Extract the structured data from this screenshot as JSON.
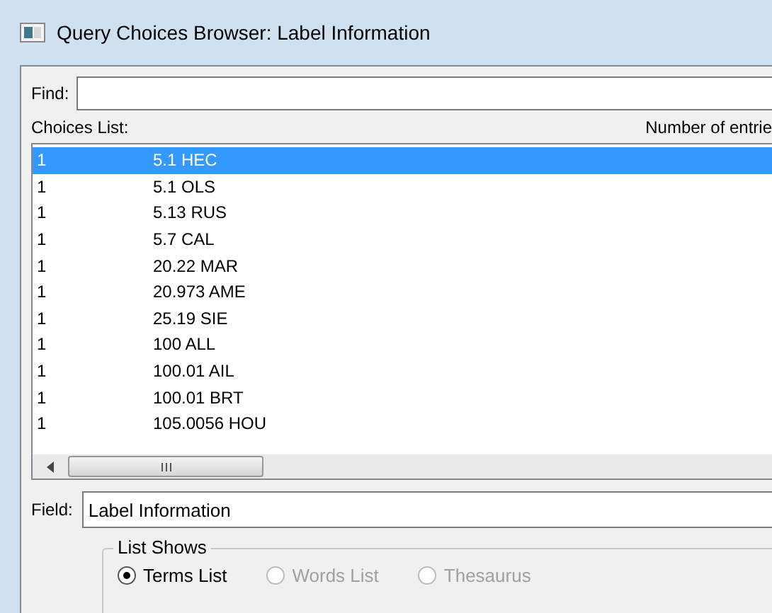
{
  "window": {
    "title": "Query Choices Browser: Label Information"
  },
  "find": {
    "label": "Find:"
  },
  "choices": {
    "label": "Choices List:",
    "count_header": "Number of entrie",
    "rows": [
      {
        "count": "1",
        "name": "5.1 HEC",
        "selected": true
      },
      {
        "count": "1",
        "name": "5.1 OLS",
        "selected": false
      },
      {
        "count": "1",
        "name": "5.13 RUS",
        "selected": false
      },
      {
        "count": "1",
        "name": "5.7 CAL",
        "selected": false
      },
      {
        "count": "1",
        "name": "20.22 MAR",
        "selected": false
      },
      {
        "count": "1",
        "name": "20.973 AME",
        "selected": false
      },
      {
        "count": "1",
        "name": "25.19 SIE",
        "selected": false
      },
      {
        "count": "1",
        "name": "100 ALL",
        "selected": false
      },
      {
        "count": "1",
        "name": "100.01 AIL",
        "selected": false
      },
      {
        "count": "1",
        "name": "100.01 BRT",
        "selected": false
      },
      {
        "count": "1",
        "name": "105.0056 HOU",
        "selected": false
      }
    ]
  },
  "field": {
    "label": "Field:",
    "value": "Label Information"
  },
  "list_shows": {
    "label": "List Shows",
    "options": [
      {
        "label": "Terms List",
        "selected": true,
        "disabled": false
      },
      {
        "label": "Words List",
        "selected": false,
        "disabled": true
      },
      {
        "label": "Thesaurus",
        "selected": false,
        "disabled": true
      }
    ]
  }
}
